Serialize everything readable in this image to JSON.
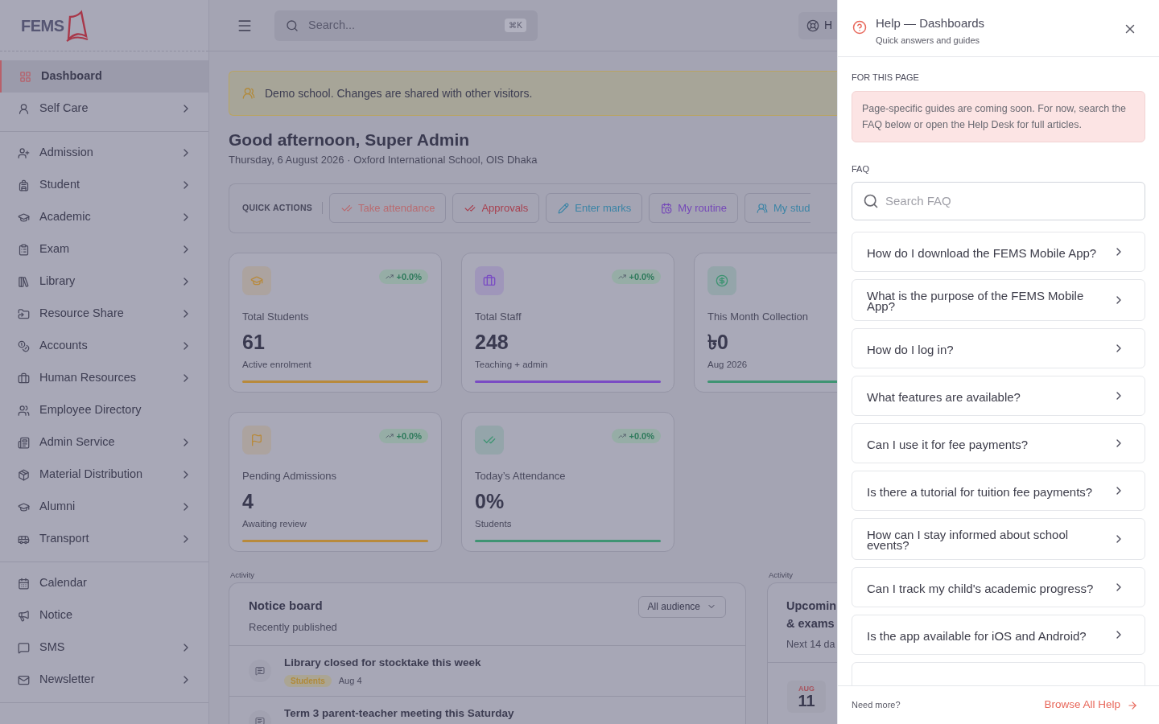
{
  "logo": {
    "text": "FEMS"
  },
  "sidebar": {
    "sections": [
      {
        "items": [
          {
            "label": "Dashboard",
            "selected": true,
            "submenu": false
          },
          {
            "label": "Self Care",
            "selected": false,
            "submenu": true
          }
        ]
      },
      {
        "items": [
          {
            "label": "Admission",
            "selected": false,
            "submenu": true
          },
          {
            "label": "Student",
            "selected": false,
            "submenu": true
          },
          {
            "label": "Academic",
            "selected": false,
            "submenu": true
          },
          {
            "label": "Exam",
            "selected": false,
            "submenu": true
          },
          {
            "label": "Library",
            "selected": false,
            "submenu": true
          },
          {
            "label": "Resource Share",
            "selected": false,
            "submenu": true
          },
          {
            "label": "Accounts",
            "selected": false,
            "submenu": true
          },
          {
            "label": "Human Resources",
            "selected": false,
            "submenu": true
          },
          {
            "label": "Employee Directory",
            "selected": false,
            "submenu": false
          },
          {
            "label": "Admin Service",
            "selected": false,
            "submenu": true
          },
          {
            "label": "Material Distribution",
            "selected": false,
            "submenu": true
          },
          {
            "label": "Alumni",
            "selected": false,
            "submenu": true
          },
          {
            "label": "Transport",
            "selected": false,
            "submenu": true
          }
        ]
      },
      {
        "items": [
          {
            "label": "Calendar",
            "selected": false,
            "submenu": false
          },
          {
            "label": "Notice",
            "selected": false,
            "submenu": false
          },
          {
            "label": "SMS",
            "selected": false,
            "submenu": true
          },
          {
            "label": "Newsletter",
            "selected": false,
            "submenu": true
          }
        ]
      }
    ]
  },
  "topbar": {
    "search": {
      "placeholder": "Search...",
      "shortcut": "⌘K"
    },
    "help_button": "H"
  },
  "banner": "Demo school. Changes are shared with other visitors.",
  "greeting": {
    "title": "Good afternoon, Super Admin",
    "subtitle": "Thursday, 6 August 2026 · Oxford International School, OIS Dhaka"
  },
  "quick_actions": {
    "label": "QUICK ACTIONS",
    "items": [
      {
        "label": "Take attendance",
        "color": "#b96b70",
        "cut": false
      },
      {
        "label": "Approvals",
        "color": "#a8404f",
        "cut": false
      },
      {
        "label": "Enter marks",
        "color": "#3b84a6",
        "cut": false
      },
      {
        "label": "My routine",
        "color": "#7548b8",
        "cut": false
      },
      {
        "label": "My stud",
        "color": "#3b84a6",
        "cut": true
      }
    ]
  },
  "stats": [
    {
      "title": "Total Students",
      "value": "61",
      "note": "Active enrolment",
      "trend": "+0.0%",
      "color": "#b88a3c",
      "trend_shown": true
    },
    {
      "title": "Total Staff",
      "value": "248",
      "note": "Teaching + admin",
      "trend": "+0.0%",
      "color": "#7a4cc4",
      "trend_shown": true
    },
    {
      "title": "This Month Collection",
      "value": "৳0",
      "note": "Aug 2026",
      "color": "#3f9473",
      "trend_shown": false
    },
    {
      "title": "Pending Admissions",
      "value": "4",
      "note": "Awaiting review",
      "trend": "+0.0%",
      "color": "#b88a3c",
      "trend_shown": true
    },
    {
      "title": "Today’s Attendance",
      "value": "0%",
      "note": "Students",
      "trend": "+0.0%",
      "color": "#3f9473",
      "trend_shown": true
    }
  ],
  "notice_board": {
    "section": "Activity",
    "title": "Notice board",
    "subtitle": "Recently published",
    "filter": "All audience",
    "items": [
      {
        "title": "Library closed for stocktake this week",
        "tag": "Students",
        "date": "Aug 4"
      },
      {
        "title": "Term 3 parent-teacher meeting this Saturday"
      }
    ]
  },
  "upcoming": {
    "section": "Activity",
    "title_lines": [
      "Upcomin",
      "& exams"
    ],
    "subtitle": "Next 14 da",
    "events": [
      {
        "month": "AUG",
        "day": "11"
      }
    ]
  },
  "help_panel": {
    "title": "Help — Dashboards",
    "subtitle": "Quick answers and guides",
    "page_section": "FOR THIS PAGE",
    "notice": "Page-specific guides are coming soon. For now, search the FAQ below or open the Help Desk for full articles.",
    "faq_section": "FAQ",
    "search_placeholder": "Search FAQ",
    "faq": [
      "How do I download the FEMS Mobile App?",
      "What is the purpose of the FEMS Mobile App?",
      "How do I log in?",
      "What features are available?",
      "Can I use it for fee payments?",
      "Is there a tutorial for tuition fee payments?",
      "How can I stay informed about school events?",
      "Can I track my child's academic progress?",
      "Is the app available for iOS and Android?"
    ],
    "footer_text": "Need more?",
    "footer_link": "Browse All Help"
  }
}
